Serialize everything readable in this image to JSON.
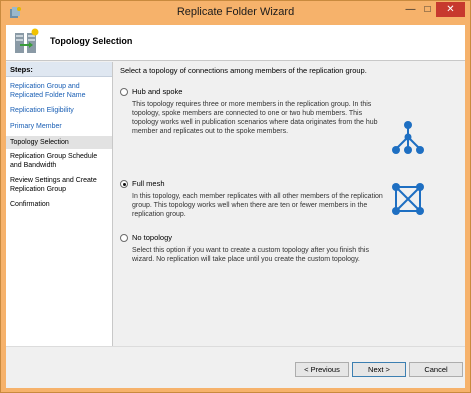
{
  "window": {
    "title": "Replicate Folder Wizard",
    "controls": {
      "minimize": "—",
      "maximize": "□",
      "close": "✕"
    }
  },
  "header": {
    "title": "Topology Selection",
    "icon": "replication-wizard-icon"
  },
  "steps": {
    "heading": "Steps:",
    "items": [
      {
        "label": "Replication Group and Replicated Folder Name",
        "state": "link"
      },
      {
        "label": "Replication Eligibility",
        "state": "link"
      },
      {
        "label": "Primary Member",
        "state": "link"
      },
      {
        "label": "Topology Selection",
        "state": "current"
      },
      {
        "label": "Replication Group Schedule and Bandwidth",
        "state": "plain"
      },
      {
        "label": "Review Settings and Create Replication Group",
        "state": "plain"
      },
      {
        "label": "Confirmation",
        "state": "plain"
      }
    ]
  },
  "main": {
    "intro": "Select a topology of connections among members of the replication group.",
    "options": [
      {
        "label": "Hub and spoke",
        "selected": false,
        "description": "This topology requires three or more members in the replication group. In this topology, spoke members are connected to one or two hub members. This topology works well in publication scenarios where data originates from the hub member and replicates out to the spoke members.",
        "icon": "hub-spoke-topology-icon"
      },
      {
        "label": "Full mesh",
        "selected": true,
        "description": "In this topology, each member replicates with all other members of the replication group. This topology works well when there are ten or fewer members in the replication group.",
        "icon": "full-mesh-topology-icon"
      },
      {
        "label": "No topology",
        "selected": false,
        "description": "Select this option if you want to create a custom topology after you finish this wizard. No replication will take place until you create the custom topology."
      }
    ]
  },
  "footer": {
    "previous": "< Previous",
    "next": "Next >",
    "cancel": "Cancel"
  },
  "colors": {
    "titlebar": "#f6b26b",
    "link": "#1a5fb4",
    "icon_blue": "#1e6fc2",
    "close": "#c7392e"
  }
}
